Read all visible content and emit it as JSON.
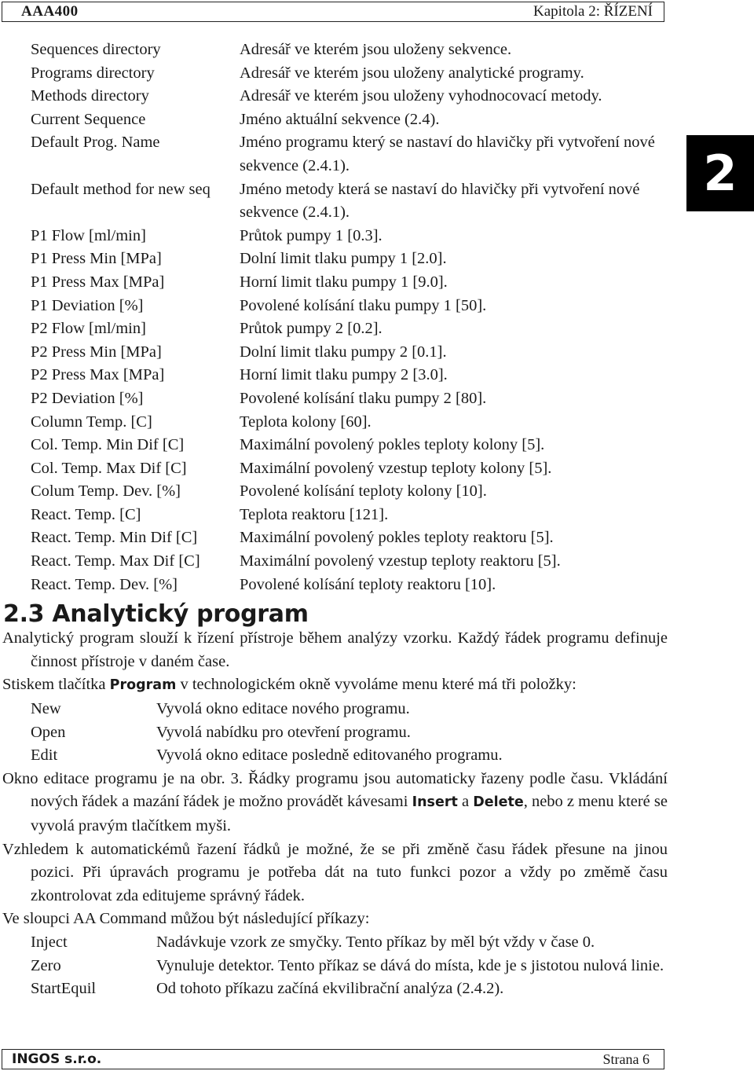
{
  "header": {
    "product": "AAA400",
    "chapter": "Kapitola 2: ŘÍZENÍ"
  },
  "chapter_tab": "2",
  "settings": [
    {
      "term": "Sequences directory",
      "desc": "Adresář ve kterém jsou uloženy sekvence."
    },
    {
      "term": "Programs directory",
      "desc": "Adresář ve kterém jsou uloženy analytické programy."
    },
    {
      "term": "Methods directory",
      "desc": "Adresář ve kterém jsou uloženy vyhodnocovací metody."
    },
    {
      "term": "Current Sequence",
      "desc": "Jméno aktuální sekvence (2.4)."
    },
    {
      "term": "Default Prog. Name",
      "desc": "Jméno programu který se nastaví do hlavičky při vytvoření nové sekvence (2.4.1)."
    },
    {
      "term": "Default method for new seq",
      "desc": "Jméno metody která se nastaví do hlavičky při vytvoření nové sekvence (2.4.1)."
    },
    {
      "term": "P1 Flow [ml/min]",
      "desc": "Průtok pumpy 1 [0.3]."
    },
    {
      "term": "P1 Press Min [MPa]",
      "desc": "Dolní limit tlaku pumpy 1 [2.0]."
    },
    {
      "term": "P1 Press Max [MPa]",
      "desc": "Horní limit tlaku pumpy 1 [9.0]."
    },
    {
      "term": "P1 Deviation [%]",
      "desc": "Povolené kolísání tlaku pumpy 1 [50]."
    },
    {
      "term": "P2 Flow [ml/min]",
      "desc": "Průtok pumpy 2 [0.2]."
    },
    {
      "term": "P2 Press Min [MPa]",
      "desc": "Dolní limit tlaku pumpy 2 [0.1]."
    },
    {
      "term": "P2 Press Max [MPa]",
      "desc": "Horní limit tlaku pumpy 2 [3.0]."
    },
    {
      "term": "P2 Deviation [%]",
      "desc": "Povolené kolísání tlaku pumpy 2 [80]."
    },
    {
      "term": "Column Temp. [C]",
      "desc": "Teplota kolony [60]."
    },
    {
      "term": "Col. Temp. Min Dif [C]",
      "desc": "Maximální povolený pokles teploty kolony [5]."
    },
    {
      "term": "Col. Temp. Max Dif [C]",
      "desc": "Maximální povolený vzestup teploty kolony [5]."
    },
    {
      "term": "Colum Temp. Dev. [%]",
      "desc": "Povolené kolísání teploty kolony [10]."
    },
    {
      "term": "React. Temp. [C]",
      "desc": "Teplota reaktoru [121]."
    },
    {
      "term": "React. Temp. Min Dif [C]",
      "desc": "Maximální povolený pokles teploty reaktoru [5]."
    },
    {
      "term": "React. Temp. Max Dif [C]",
      "desc": "Maximální povolený vzestup teploty reaktoru [5]."
    },
    {
      "term": "React. Temp. Dev. [%]",
      "desc": "Povolené kolísání teploty reaktoru [10]."
    }
  ],
  "section": {
    "title": "2.3 Analytický program",
    "intro": "Analytický program slouží k řízení přístroje během analýzy vzorku. Každý řádek programu definuje činnost přístroje v daném čase.",
    "menu_intro_before": "Stiskem tlačítka ",
    "menu_intro_keyword": "Program",
    "menu_intro_after": " v technologickém okně vyvoláme menu které má tři položky:",
    "menu_items": [
      {
        "term": "New",
        "desc": "Vyvolá okno editace nového programu."
      },
      {
        "term": "Open",
        "desc": "Vyvolá nabídku pro otevření programu."
      },
      {
        "term": "Edit",
        "desc": "Vyvolá okno editace posledně editovaného programu."
      }
    ],
    "edit_para_before": "Okno editace programu je na obr. 3. Řádky programu jsou automaticky řazeny podle času. Vkládání nových řádek a mazání řádek je možno provádět kávesami ",
    "edit_para_key1": "Insert",
    "edit_para_mid": " a ",
    "edit_para_key2": "Delete",
    "edit_para_after": ", nebo z menu které se vyvolá pravým tlačítkem myši.",
    "sort_para": "Vzhledem k automatickémů řazení řádků je možné, že se při změně času řádek přesune na jinou pozici. Při úpravách programu je potřeba dát na tuto funkci pozor a vždy po změmě času zkontrolovat zda editujeme správný řádek.",
    "commands_intro": "Ve sloupci AA Command můžou být následující příkazy:",
    "commands": [
      {
        "term": "Inject",
        "desc": "Nadávkuje vzork ze smyčky. Tento příkaz by měl být vždy v čase 0."
      },
      {
        "term": "Zero",
        "desc": "Vynuluje detektor. Tento příkaz se dává do místa, kde je s jistotou nulová linie."
      },
      {
        "term": "StartEquil",
        "desc": "Od tohoto příkazu začíná ekvilibrační analýza (2.4.2)."
      }
    ]
  },
  "footer": {
    "company": "INGOS s.r.o.",
    "page": "Strana 6"
  }
}
